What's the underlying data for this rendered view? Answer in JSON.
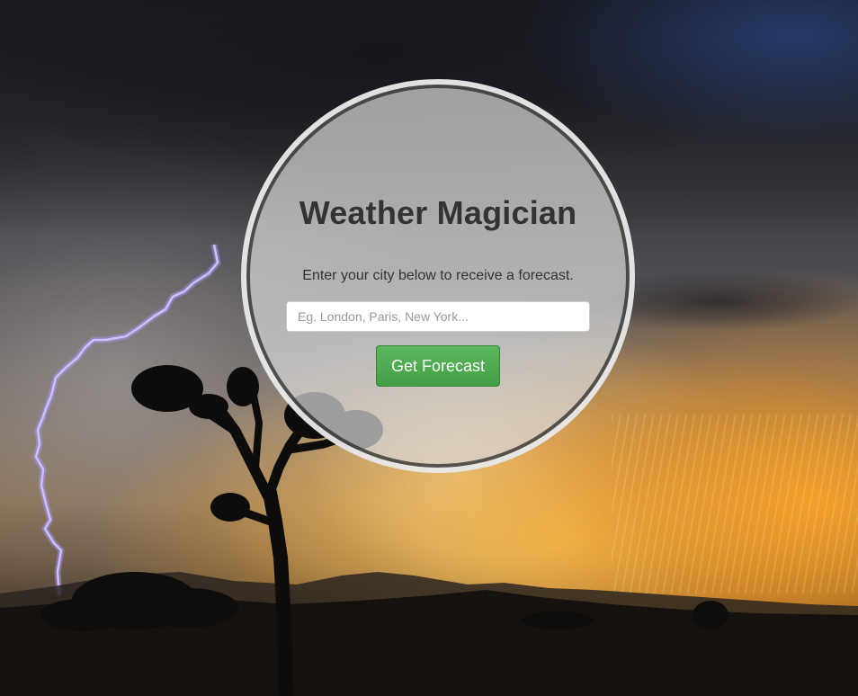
{
  "app": {
    "title": "Weather Magician",
    "subtitle": "Enter your city below to receive a forecast."
  },
  "search": {
    "value": "",
    "placeholder": "Eg. London, Paris, New York..."
  },
  "actions": {
    "forecast_label": "Get Forecast"
  },
  "background": {
    "scene": "desert thunderstorm at sunset with lightning bolt and joshua tree silhouette"
  },
  "colors": {
    "button_green": "#5cb85c",
    "title_text": "#333333",
    "panel_fill": "#d7d7d7"
  }
}
